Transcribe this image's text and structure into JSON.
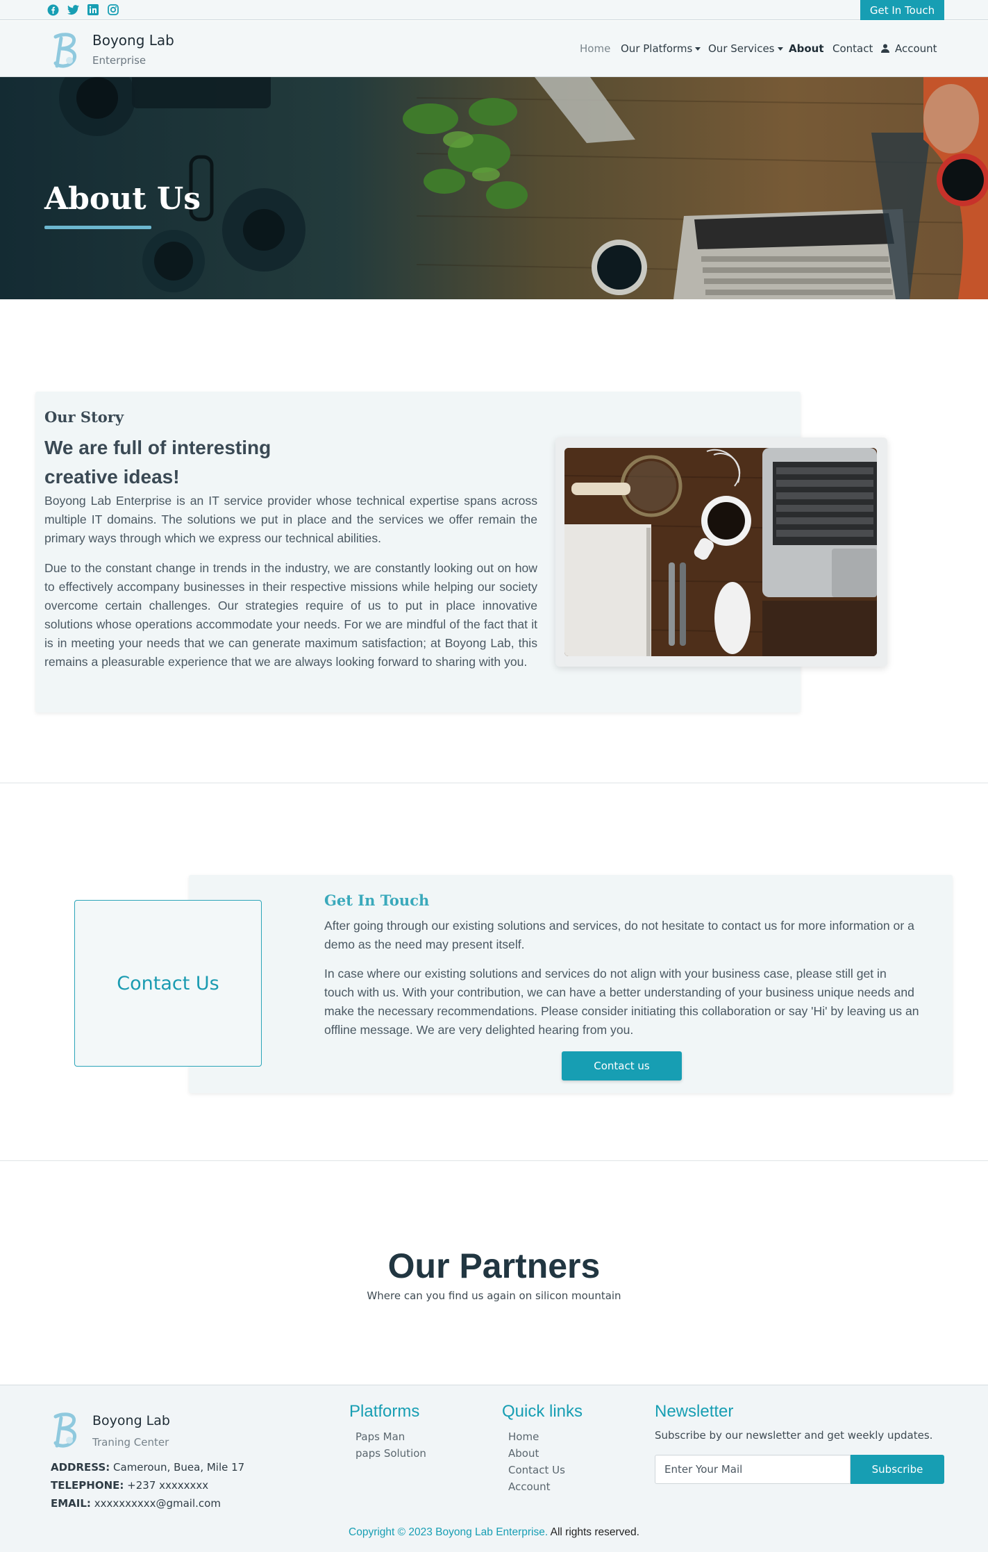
{
  "topbar": {
    "social": [
      "facebook-icon",
      "twitter-icon",
      "linkedin-icon",
      "instagram-icon"
    ],
    "cta_label": "Get In Touch"
  },
  "nav": {
    "brand_name": "Boyong Lab",
    "brand_sub": "Enterprise",
    "items": [
      {
        "label": "Home"
      },
      {
        "label": "Our Platforms"
      },
      {
        "label": "Our Services"
      },
      {
        "label": "About"
      },
      {
        "label": "Contact"
      },
      {
        "label": "Account"
      }
    ],
    "active": "About"
  },
  "hero": {
    "title": "About Us"
  },
  "story": {
    "kicker": "Our Story",
    "heading_line1": "We are full of interesting",
    "heading_line2": "creative ideas!",
    "p1": "Boyong Lab Enterprise is an IT service provider whose technical expertise spans across multiple IT domains. The solutions we put in place and the services we offer remain the primary ways through which we express our technical abilities.",
    "p2": "Due to the constant change in trends in the industry, we are constantly looking out on how to effectively accompany businesses in their respective missions while helping our society overcome certain challenges. Our strategies require of us to put in place innovative solutions whose operations accommodate your needs. For we are mindful of the fact that it is in meeting your needs that we can generate maximum satisfaction; at Boyong Lab, this remains a pleasurable experience that we are always looking forward to sharing with you."
  },
  "contact": {
    "box_label": "Contact Us",
    "title": "Get In Touch",
    "p1": "After going through our existing solutions and services, do not hesitate to contact us for more information or a demo as the need may present itself.",
    "p2": "In case where our existing solutions and services do not align with your business case, please still get in touch with us. With your contribution, we can have a better understanding of your business unique needs and make the necessary recommendations. Please consider initiating this collaboration or say 'Hi' by leaving us an offline message. We are very delighted hearing from you.",
    "button": "Contact us"
  },
  "partners": {
    "title": "Our Partners",
    "subtitle": "Where can you find us again on silicon mountain"
  },
  "footer": {
    "brand_name": "Boyong Lab",
    "brand_sub": "Traning Center",
    "address_label": "ADDRESS:",
    "address": "Cameroun, Buea, Mile 17",
    "telephone_label": "TELEPHONE:",
    "telephone": "+237 xxxxxxxx",
    "email_label": "EMAIL:",
    "email": "xxxxxxxxxx@gmail.com",
    "platforms_title": "Platforms",
    "platforms": [
      "Paps Man",
      "paps Solution"
    ],
    "quick_title": "Quick links",
    "quick_links": [
      "Home",
      "About",
      "Contact Us",
      "Account"
    ],
    "news_title": "Newsletter",
    "news_text": "Subscribe by our newsletter and get weekly updates.",
    "news_placeholder": "Enter Your Mail",
    "news_button": "Subscribe",
    "copyright_a": "Copyright © 2023 Boyong Lab Enterprise.",
    "copyright_b": "All rights reserved."
  },
  "colors": {
    "accent": "#179eb3",
    "heading": "#213641",
    "card": "#f1f6f7"
  }
}
